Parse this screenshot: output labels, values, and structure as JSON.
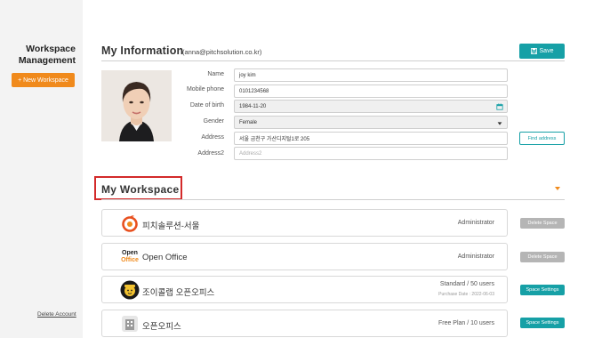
{
  "sidebar": {
    "title": "Workspace\nManagement",
    "new_workspace_label": "+ New Workspace",
    "delete_account_label": "Delete Account"
  },
  "my_information": {
    "title": "My Information",
    "email": "(anna@pitchsolution.co.kr)",
    "save_label": "Save",
    "fields": {
      "name": {
        "label": "Name",
        "value": "joy kim"
      },
      "mobile": {
        "label": "Mobile phone",
        "value": "0101234568"
      },
      "dob": {
        "label": "Date of birth",
        "value": "1984-11-20"
      },
      "gender": {
        "label": "Gender",
        "value": "Female"
      },
      "address": {
        "label": "Address",
        "value": "서울 금천구 가산디지털1로 205"
      },
      "address2": {
        "label": "Address2",
        "placeholder": "Address2"
      }
    },
    "find_address_label": "Find address"
  },
  "my_workspace": {
    "title": "My Workspace",
    "items": [
      {
        "name": "피치솔루션-서울",
        "role": "Administrator",
        "sub": "",
        "button": "Delete Space",
        "logo": "pitch-logo"
      },
      {
        "name": "Open Office",
        "role": "Administrator",
        "sub": "",
        "button": "Delete Space",
        "logo": "openoffice-logo",
        "logo_top": "Open",
        "logo_bottom": "Office"
      },
      {
        "name": "조이콜랩 오픈오피스",
        "role": "Standard / 50 users",
        "sub": "Purchase Date : 2022-06-03",
        "button": "Space Settings",
        "logo": "joycollab-logo"
      },
      {
        "name": "오픈오피스",
        "role": "Free Plan / 10 users",
        "sub": "",
        "button": "Space Settings",
        "logo": "building-logo"
      }
    ]
  },
  "colors": {
    "accent": "#f08a1c",
    "teal": "#16a0a6",
    "highlight": "#d32a2a"
  },
  "icons": {
    "save": "save-icon",
    "calendar": "calendar-icon",
    "dropdown": "chevron-down-icon",
    "collapse": "caret-down-icon"
  }
}
